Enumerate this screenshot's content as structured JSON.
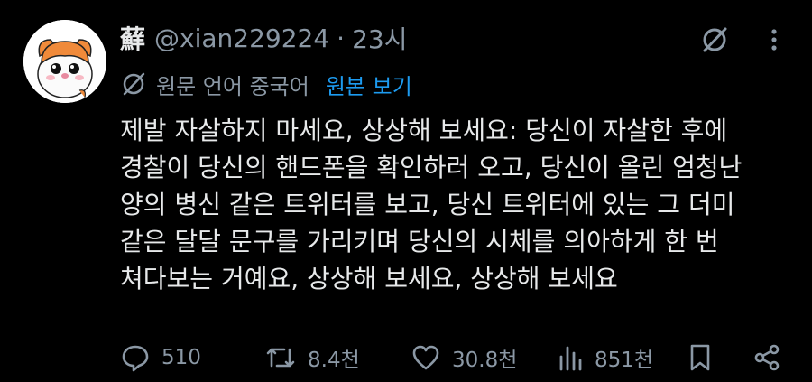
{
  "post": {
    "display_name": "蘚",
    "handle": "@xian229224",
    "separator": "·",
    "time": "23시",
    "translation_note": "원문 언어 중국어",
    "show_original_label": "원본 보기",
    "body": "제발 자살하지 마세요, 상상해 보세요: 당신이 자살한 후에\n경찰이 당신의 핸드폰을 확인하러 오고, 당신이 올린 엄청난\n양의 병신 같은 트위터를 보고, 당신 트위터에 있는 그 더미\n같은 달달 문구를 가리키며 당신의 시체를 의아하게 한 번\n쳐다보는 거예요, 상상해 보세요, 상상해 보세요"
  },
  "actions": {
    "replies": "510",
    "reposts": "8.4천",
    "likes": "30.8천",
    "views": "851천"
  },
  "icons": [
    "grok-icon",
    "more-icon",
    "translate-icon",
    "reply-icon",
    "repost-icon",
    "like-icon",
    "views-icon",
    "bookmark-icon",
    "share-icon"
  ],
  "colors": {
    "background": "#000000",
    "text": "#e7e9ea",
    "secondary": "#8b98a5",
    "link": "#1d9bf0"
  }
}
